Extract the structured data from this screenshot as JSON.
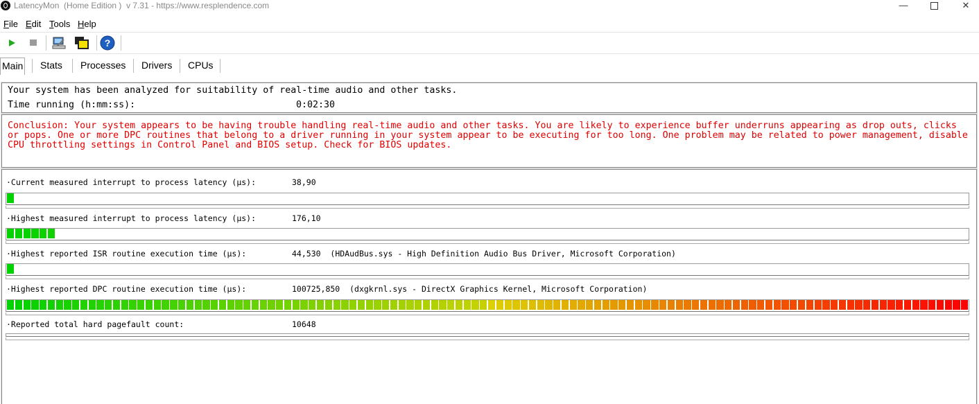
{
  "window": {
    "title": "LatencyMon  (Home Edition )  v 7.31 - https://www.resplendence.com",
    "min_glyph": "—",
    "close_glyph": "✕"
  },
  "menu": {
    "items": [
      "File",
      "Edit",
      "Tools",
      "Help"
    ]
  },
  "toolbar": {
    "icons": [
      "play-icon",
      "stop-icon",
      "monitor-icon",
      "windows-icon",
      "help-icon"
    ],
    "play_color": "#22aa22",
    "help_color": "#1f5fbf"
  },
  "tabs": [
    "Main",
    "Stats",
    "Processes",
    "Drivers",
    "CPUs"
  ],
  "main": {
    "summary": "Your system has been analyzed for suitability of real-time audio and other tasks.",
    "time_label": "Time running (h:mm:ss):",
    "time_value": "0:02:30",
    "conclusion": "Conclusion: Your system appears to be having trouble handling real-time audio and other tasks. You are likely to experience buffer underruns appearing as drop outs, clicks or pops. One or more DPC routines that belong to a driver running in your system appear to be executing for too long. One problem may be related to power management, disable CPU throttling settings in Control Panel and BIOS setup. Check for BIOS updates.",
    "conclusion_color": "#e00000",
    "metrics": [
      {
        "label": "·Current measured interrupt to process latency (µs):",
        "value": "38,90",
        "detail": "",
        "bar_segments": 1
      },
      {
        "label": "·Highest measured interrupt to process latency (µs):",
        "value": "176,10",
        "detail": "",
        "bar_segments": 6
      },
      {
        "label": "·Highest reported ISR routine execution time (µs):",
        "value": "44,530",
        "detail": "(HDAudBus.sys - High Definition Audio Bus Driver, Microsoft Corporation)",
        "bar_segments": 1
      },
      {
        "label": "·Highest reported DPC routine execution time (µs):",
        "value": "100725,850",
        "detail": "(dxgkrnl.sys - DirectX Graphics Kernel, Microsoft Corporation)",
        "bar_segments": 118
      },
      {
        "label": "·Reported total hard pagefault count:",
        "value": "10648",
        "detail": "",
        "bar_segments": 0
      }
    ],
    "bar_total_segments": 118
  }
}
